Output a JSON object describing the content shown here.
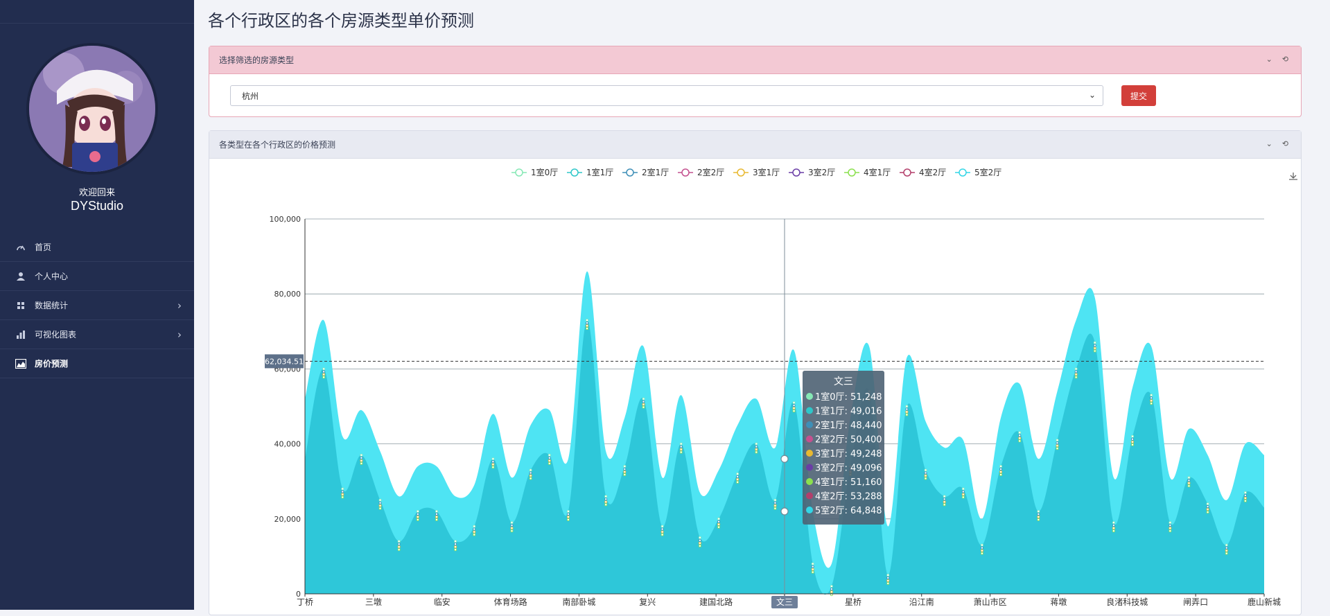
{
  "sidebar": {
    "welcome": "欢迎回来",
    "username": "DYStudio",
    "items": [
      {
        "label": "首页",
        "icon": "speedometer-icon"
      },
      {
        "label": "个人中心",
        "icon": "user-icon"
      },
      {
        "label": "数据统计",
        "icon": "grid-icon"
      },
      {
        "label": "可视化图表",
        "icon": "bar-chart-icon"
      },
      {
        "label": "房价预测",
        "icon": "area-chart-icon"
      }
    ]
  },
  "page": {
    "title": "各个行政区的各个房源类型单价预测"
  },
  "filter_panel": {
    "title": "选择筛选的房源类型",
    "select_value": "杭州",
    "submit_label": "提交"
  },
  "chart_panel": {
    "title": "各类型在各个行政区的价格预测"
  },
  "tooltip": {
    "title": "文三",
    "rows": [
      "1室0厅: 51,248",
      "1室1厅: 49,016",
      "2室1厅: 48,440",
      "2室2厅: 50,400",
      "3室1厅: 49,248",
      "3室2厅: 49,096",
      "4室1厅: 51,160",
      "4室2厅: 53,288",
      "5室2厅: 64,848"
    ]
  },
  "axis_pointer_label": "62,034.51",
  "colors": {
    "sidebar_bg": "#222d4f",
    "area_dark": "#2ec7d9",
    "area_light": "#4ee4f3",
    "submit_red": "#d23f3a",
    "series": [
      "#86e8b5",
      "#2ec7c9",
      "#3e8fb7",
      "#c4508f",
      "#e8b830",
      "#6a3da6",
      "#8be04e",
      "#b33f6b",
      "#33d6e6"
    ]
  },
  "chart_data": {
    "type": "area",
    "x": [
      "丁桥",
      "三墩",
      "临安",
      "体育场路",
      "南部卧城",
      "复兴",
      "建国北路",
      "文三",
      "星桥",
      "沿江南",
      "萧山市区",
      "蒋墩",
      "良渚科技城",
      "闸弄口",
      "鹿山新城"
    ],
    "ylim": [
      0,
      100000
    ],
    "yticks": [
      "0",
      "20,000",
      "40,000",
      "60,000",
      "80,000",
      "100,000"
    ],
    "legend": [
      "1室0厅",
      "1室1厅",
      "2室1厅",
      "2室2厅",
      "3室1厅",
      "3室2厅",
      "4室1厅",
      "4室2厅",
      "5室2厅"
    ],
    "series_high": {
      "name": "5室2厅",
      "values": [
        52000,
        73000,
        42000,
        49000,
        38000,
        26000,
        34000,
        34000,
        26000,
        29000,
        48000,
        31000,
        45000,
        49000,
        36000,
        86000,
        38000,
        47000,
        66000,
        31000,
        53000,
        27000,
        33000,
        45000,
        52000,
        39000,
        65000,
        22000,
        8000,
        47000,
        66000,
        18000,
        63000,
        46000,
        39000,
        41000,
        20000,
        47000,
        56000,
        36000,
        54000,
        73000,
        79000,
        31000,
        55000,
        66000,
        31000,
        44000,
        37000,
        25000,
        40000,
        37000
      ]
    },
    "series_low": {
      "name": "3室2厅",
      "values": [
        36000,
        60000,
        28000,
        37000,
        25000,
        14000,
        22000,
        22000,
        14000,
        18000,
        36000,
        19000,
        33000,
        37000,
        22000,
        73000,
        26000,
        34000,
        52000,
        18000,
        40000,
        15000,
        20000,
        32000,
        40000,
        25000,
        51000,
        8000,
        2000,
        34000,
        54000,
        5000,
        50000,
        33000,
        26000,
        28000,
        13000,
        34000,
        43000,
        22000,
        41000,
        60000,
        67000,
        19000,
        42000,
        53000,
        19000,
        31000,
        24000,
        13000,
        27000,
        23000
      ]
    }
  }
}
